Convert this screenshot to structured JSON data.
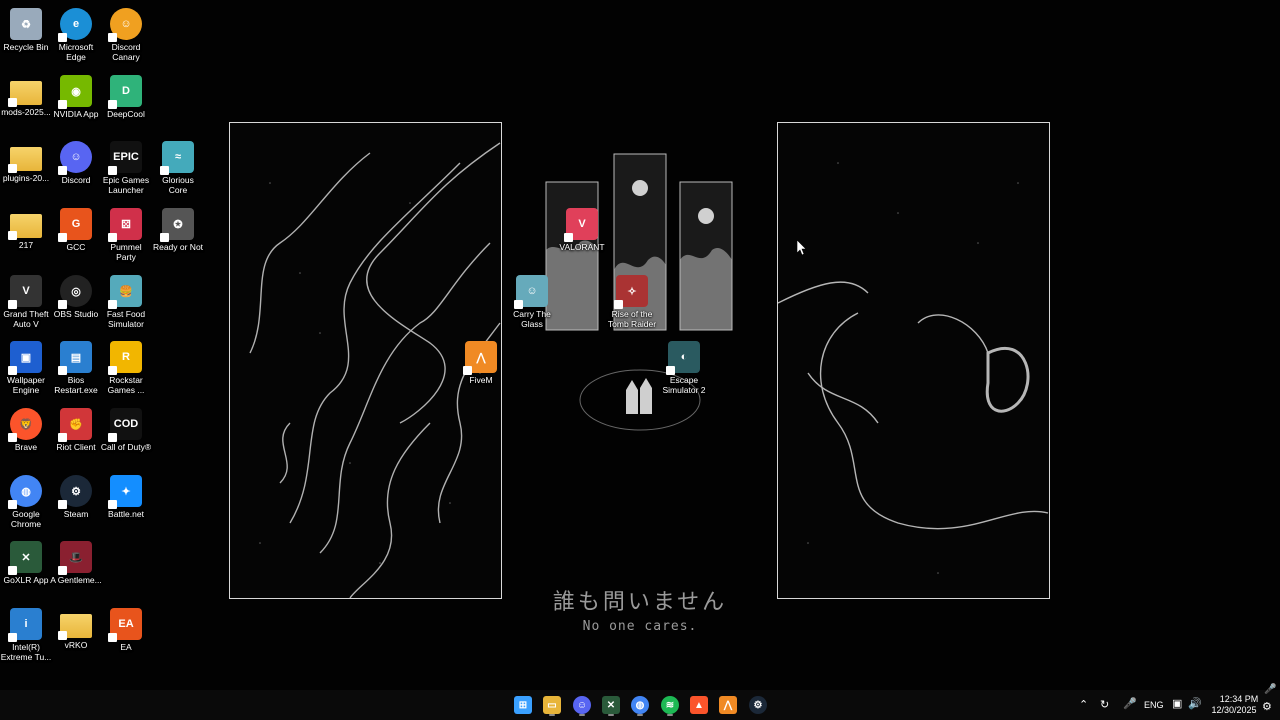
{
  "wallpaper": {
    "caption_jp": "誰も問いません",
    "caption_en": "No one cares."
  },
  "desktop_icons": [
    {
      "label": "Recycle Bin",
      "icon": "recycle-bin-icon",
      "color": "#9ab"
    },
    {
      "label": "Microsoft Edge",
      "icon": "edge-icon",
      "color": "#1b8fd6"
    },
    {
      "label": "Discord Canary",
      "icon": "discord-canary-icon",
      "color": "#f0a020"
    },
    {
      "label": "mods-2025...",
      "icon": "folder-icon",
      "color": "#e8b53a"
    },
    {
      "label": "NVIDIA App",
      "icon": "nvidia-icon",
      "color": "#76b900"
    },
    {
      "label": "DeepCool",
      "icon": "deepcool-icon",
      "color": "#2fb37a"
    },
    {
      "label": "plugins-20...",
      "icon": "folder-icon",
      "color": "#e8b53a"
    },
    {
      "label": "Discord",
      "icon": "discord-icon",
      "color": "#5865f2"
    },
    {
      "label": "Epic Games Launcher",
      "icon": "epic-games-icon",
      "color": "#111"
    },
    {
      "label": "Glorious Core",
      "icon": "glorious-icon",
      "color": "#4ab"
    },
    {
      "label": "217",
      "icon": "folder-icon",
      "color": "#e8b53a"
    },
    {
      "label": "GCC",
      "icon": "gcc-icon",
      "color": "#e8541c"
    },
    {
      "label": "Pummel Party",
      "icon": "pummel-party-icon",
      "color": "#d0304a"
    },
    {
      "label": "Ready or Not",
      "icon": "ready-or-not-icon",
      "color": "#555"
    },
    {
      "label": "Grand Theft Auto V",
      "icon": "gta-icon",
      "color": "#333"
    },
    {
      "label": "OBS Studio",
      "icon": "obs-icon",
      "color": "#222"
    },
    {
      "label": "Fast Food Simulator",
      "icon": "fast-food-icon",
      "color": "#5ab"
    },
    {
      "label": "Wallpaper Engine",
      "icon": "wallpaper-engine-icon",
      "color": "#1e5fd0"
    },
    {
      "label": "Bios Restart.exe",
      "icon": "bios-restart-icon",
      "color": "#2a7fd0"
    },
    {
      "label": "Rockstar Games ...",
      "icon": "rockstar-icon",
      "color": "#f2b600"
    },
    {
      "label": "Brave",
      "icon": "brave-icon",
      "color": "#fb542b"
    },
    {
      "label": "Riot Client",
      "icon": "riot-icon",
      "color": "#d13639"
    },
    {
      "label": "Call of Duty®",
      "icon": "call-of-duty-icon",
      "color": "#111"
    },
    {
      "label": "Google Chrome",
      "icon": "chrome-icon",
      "color": "#4285f4"
    },
    {
      "label": "Steam",
      "icon": "steam-icon",
      "color": "#1b2838"
    },
    {
      "label": "Battle.net",
      "icon": "battlenet-icon",
      "color": "#148eff"
    },
    {
      "label": "GoXLR App",
      "icon": "goxlr-icon",
      "color": "#2a5a3a"
    },
    {
      "label": "A Gentleme...",
      "icon": "gentleman-icon",
      "color": "#8a2030"
    },
    {
      "label": "Intel(R) Extreme Tu...",
      "icon": "intel-icon",
      "color": "#2a7fd0"
    },
    {
      "label": "vRKO",
      "icon": "folder-icon",
      "color": "#e8b53a"
    },
    {
      "label": "EA",
      "icon": "ea-icon",
      "color": "#e8541c"
    },
    {
      "label": "VALORANT",
      "icon": "valorant-icon",
      "color": "#e0405a"
    },
    {
      "label": "Carry The Glass",
      "icon": "carry-the-glass-icon",
      "color": "#6ab"
    },
    {
      "label": "Rise of the Tomb Raider",
      "icon": "tomb-raider-icon",
      "color": "#a33"
    },
    {
      "label": "FiveM",
      "icon": "fivem-icon",
      "color": "#f08a24"
    },
    {
      "label": "Escape Simulator 2",
      "icon": "escape-sim-icon",
      "color": "#2a5a60"
    }
  ],
  "taskbar": {
    "apps": [
      {
        "name": "start-button",
        "icon": "windows-icon",
        "color": "#3aa0ff"
      },
      {
        "name": "file-explorer",
        "icon": "folder-icon",
        "color": "#e8b53a"
      },
      {
        "name": "discord",
        "icon": "discord-icon",
        "color": "#5865f2"
      },
      {
        "name": "goxlr",
        "icon": "goxlr-icon",
        "color": "#2a5a3a"
      },
      {
        "name": "chrome",
        "icon": "chrome-icon",
        "color": "#4285f4"
      },
      {
        "name": "spotify",
        "icon": "spotify-icon",
        "color": "#1db954"
      },
      {
        "name": "brave",
        "icon": "brave-icon",
        "color": "#fb542b"
      },
      {
        "name": "fivem",
        "icon": "fivem-icon",
        "color": "#f08a24"
      },
      {
        "name": "steam",
        "icon": "steam-icon",
        "color": "#1b2838"
      }
    ],
    "tray": {
      "language": "ENG",
      "time": "12:34 PM",
      "date": "12/30/2025"
    }
  }
}
